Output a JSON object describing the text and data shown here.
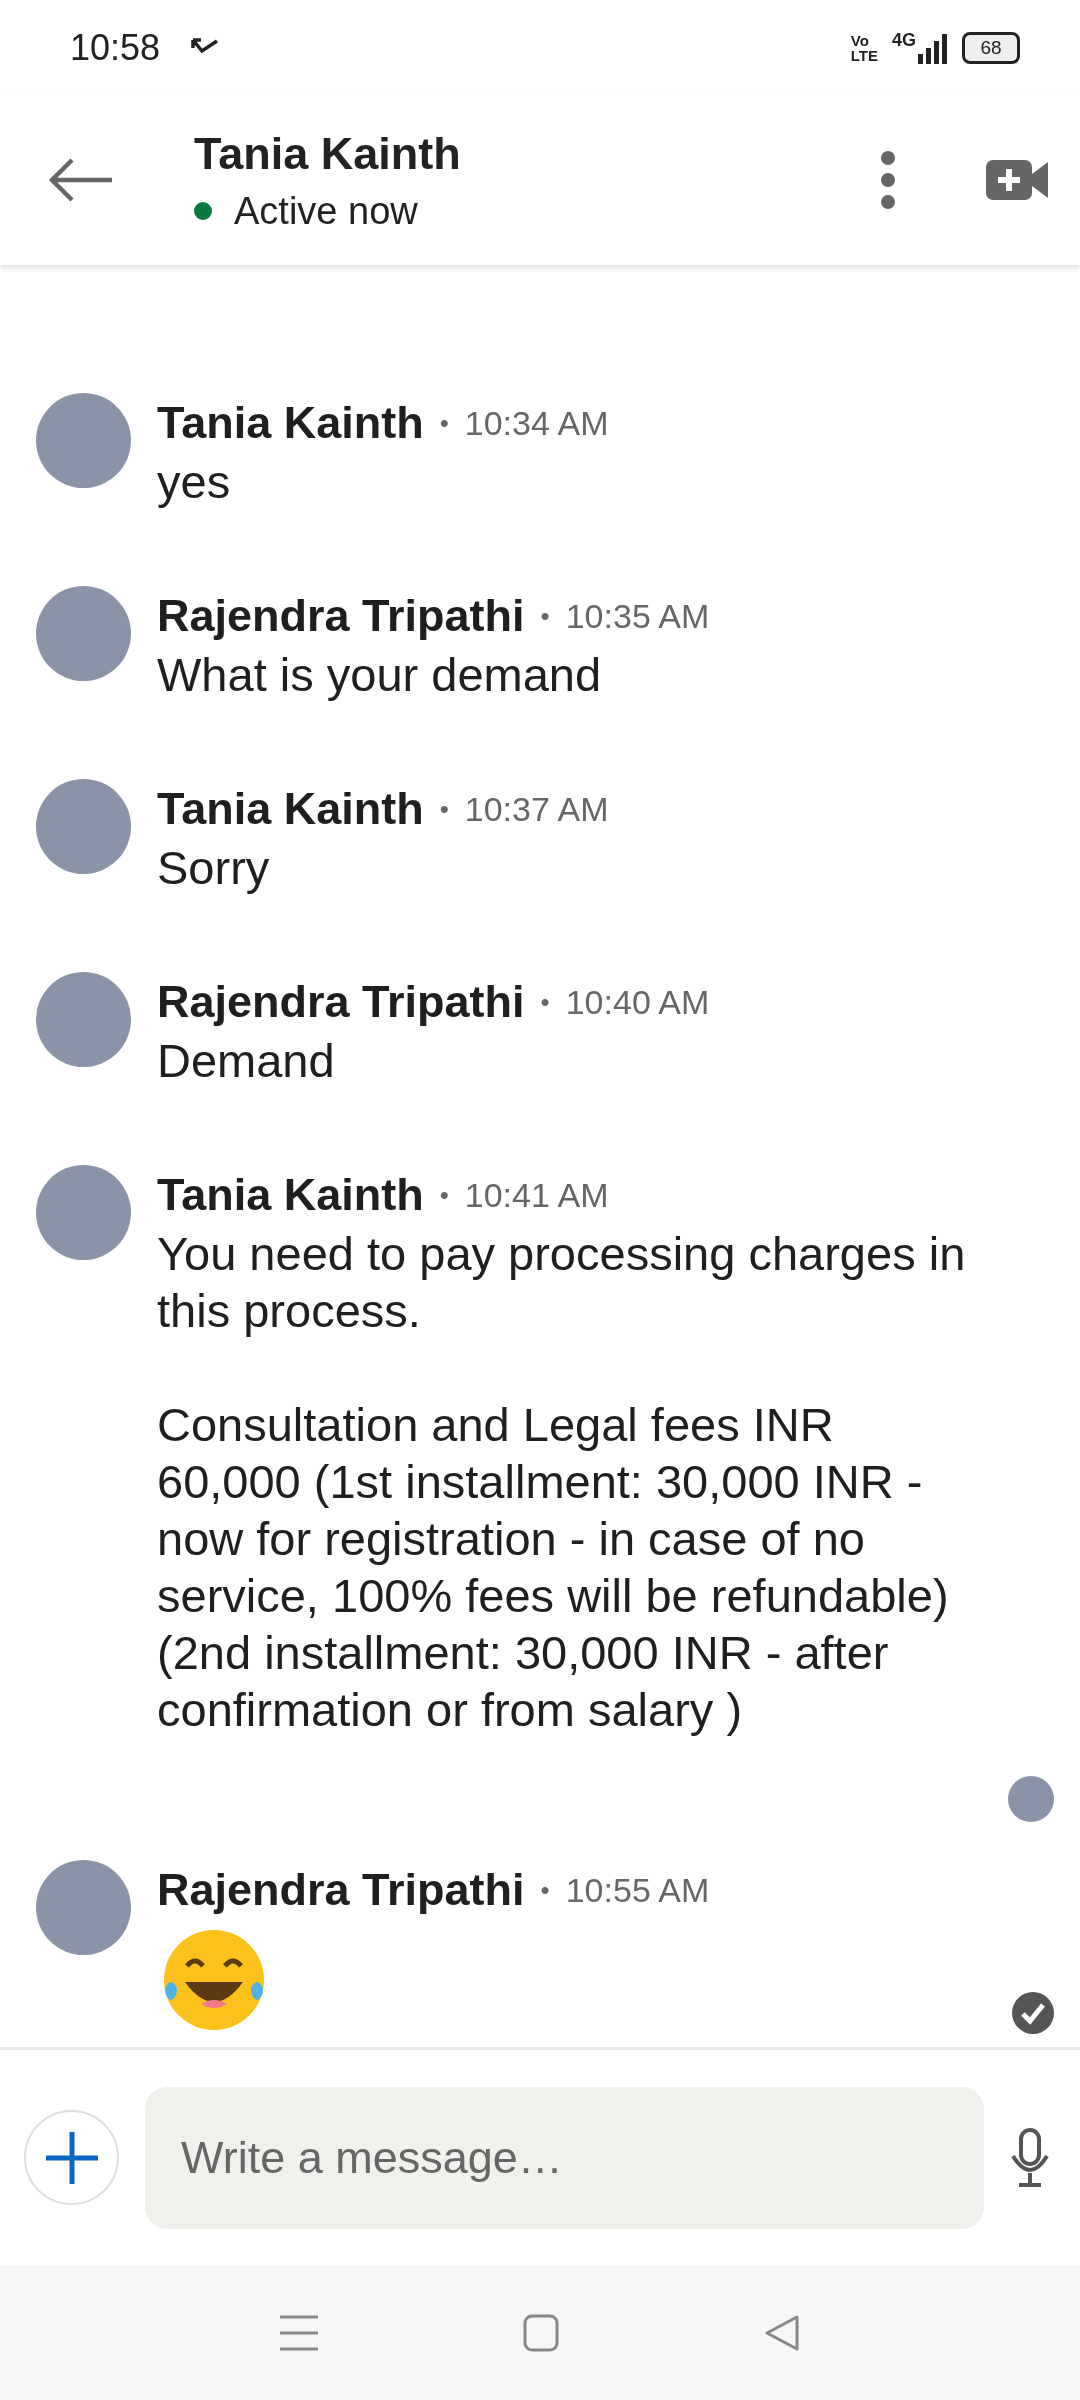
{
  "status_bar": {
    "time": "10:58",
    "volte_top": "Vo",
    "volte_bottom": "LTE",
    "network": "4G",
    "battery": "68"
  },
  "header": {
    "name": "Tania Kainth",
    "status": "Active now",
    "online": true
  },
  "messages": [
    {
      "kind": "text",
      "sender": "Tania Kainth",
      "dot": "•",
      "time": "10:34 AM",
      "text": "yes"
    },
    {
      "kind": "text",
      "sender": "Rajendra Tripathi",
      "dot": "•",
      "time": "10:35 AM",
      "text": "What is your demand"
    },
    {
      "kind": "text",
      "sender": "Tania Kainth",
      "dot": "•",
      "time": "10:37 AM",
      "text": "Sorry"
    },
    {
      "kind": "text",
      "sender": "Rajendra Tripathi",
      "dot": "•",
      "time": "10:40 AM",
      "text": "Demand"
    },
    {
      "kind": "text",
      "sender": "Tania Kainth",
      "dot": "•",
      "time": "10:41 AM",
      "text": "You need to pay processing charges in this process.\n\nConsultation and Legal fees INR 60,000 (1st installment: 30,000 INR - now for registration - in case of no service, 100% fees will be refundable) (2nd installment: 30,000 INR - after confirmation or from salary )",
      "seen": true
    },
    {
      "kind": "emoji",
      "sender": "Rajendra Tripathi",
      "dot": "•",
      "time": "10:55 AM",
      "delivered": true
    }
  ],
  "composer": {
    "placeholder": "Write a message…"
  }
}
